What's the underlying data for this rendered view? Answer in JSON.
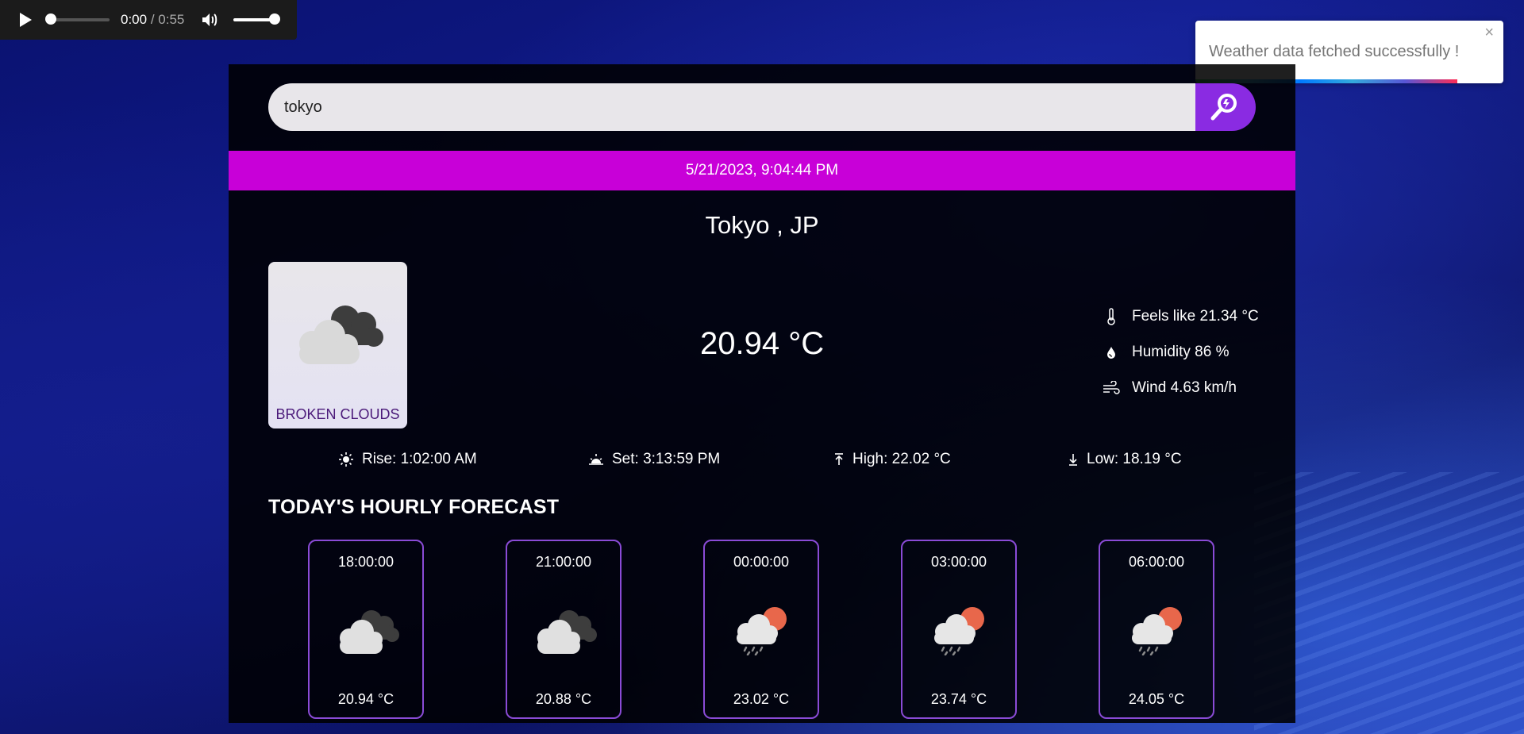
{
  "audio": {
    "current_time": "0:00",
    "separator": " / ",
    "total_time": "0:55"
  },
  "toast": {
    "message": "Weather data fetched successfully !",
    "close": "×",
    "progress": 0.85
  },
  "search": {
    "value": "tokyo"
  },
  "datetime": "5/21/2023, 9:04:44 PM",
  "location": "Tokyo , JP",
  "current": {
    "condition": "BROKEN CLOUDS",
    "icon": "broken-clouds-icon",
    "temp": "20.94 °C",
    "feels_like": "Feels like 21.34 °C",
    "humidity": "Humidity 86 %",
    "wind": "Wind 4.63 km/h"
  },
  "sun": {
    "rise": "Rise: 1:02:00 AM",
    "set": "Set: 3:13:59 PM",
    "high": "High: 22.02 °C",
    "low": "Low: 18.19 °C"
  },
  "hourly_title": "TODAY'S HOURLY FORECAST",
  "hourly": [
    {
      "time": "18:00:00",
      "temp": "20.94 °C",
      "icon": "broken-clouds-icon"
    },
    {
      "time": "21:00:00",
      "temp": "20.88 °C",
      "icon": "broken-clouds-icon"
    },
    {
      "time": "00:00:00",
      "temp": "23.02 °C",
      "icon": "rain-sun-icon"
    },
    {
      "time": "03:00:00",
      "temp": "23.74 °C",
      "icon": "rain-sun-icon"
    },
    {
      "time": "06:00:00",
      "temp": "24.05 °C",
      "icon": "rain-sun-icon"
    }
  ],
  "colors": {
    "accent": "#8a2be2",
    "date_bar": "#c800d8",
    "card_border": "#8a4bd6"
  }
}
